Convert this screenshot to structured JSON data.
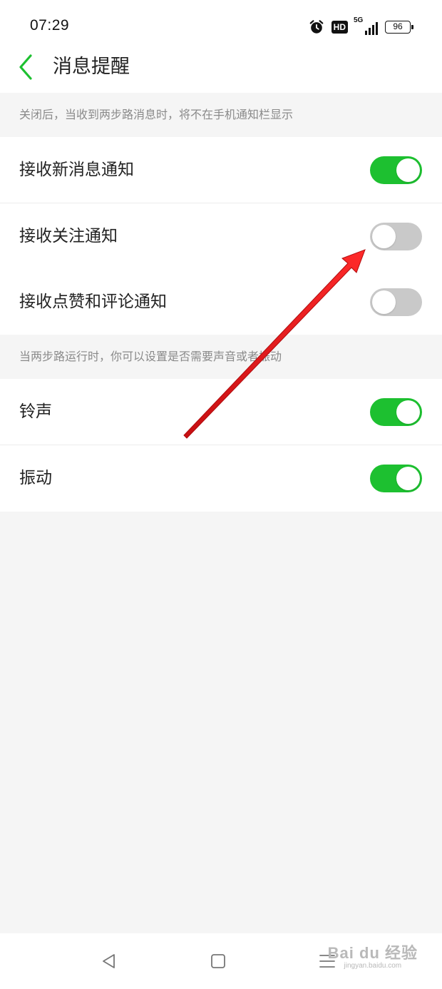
{
  "status_bar": {
    "time": "07:29",
    "icons": [
      "alarm-icon",
      "hd-icon",
      "5g-signal-icon",
      "battery-icon"
    ],
    "hd_label": "HD",
    "network_label": "5G",
    "battery_level": "96"
  },
  "header": {
    "back_icon": "chevron-left-icon",
    "title": "消息提醒"
  },
  "sections": [
    {
      "hint": "关闭后，当收到两步路消息时，将不在手机通知栏显示",
      "rows": [
        {
          "label": "接收新消息通知",
          "enabled": true
        },
        {
          "label": "接收关注通知",
          "enabled": false
        },
        {
          "label": "接收点赞和评论通知",
          "enabled": false
        }
      ]
    },
    {
      "hint": "当两步路运行时，你可以设置是否需要声音或者振动",
      "rows": [
        {
          "label": "铃声",
          "enabled": true
        },
        {
          "label": "振动",
          "enabled": true
        }
      ]
    }
  ],
  "nav_bar": {
    "buttons": [
      "back-triangle-icon",
      "home-square-icon",
      "menu-lines-icon"
    ]
  },
  "watermark": {
    "main": "Bai du 经验",
    "sub": "jingyan.baidu.com"
  },
  "colors": {
    "accent": "#1dc030",
    "toggle_off": "#c9c9c9",
    "annotation_arrow": "#e8191b",
    "background": "#f5f5f5"
  }
}
